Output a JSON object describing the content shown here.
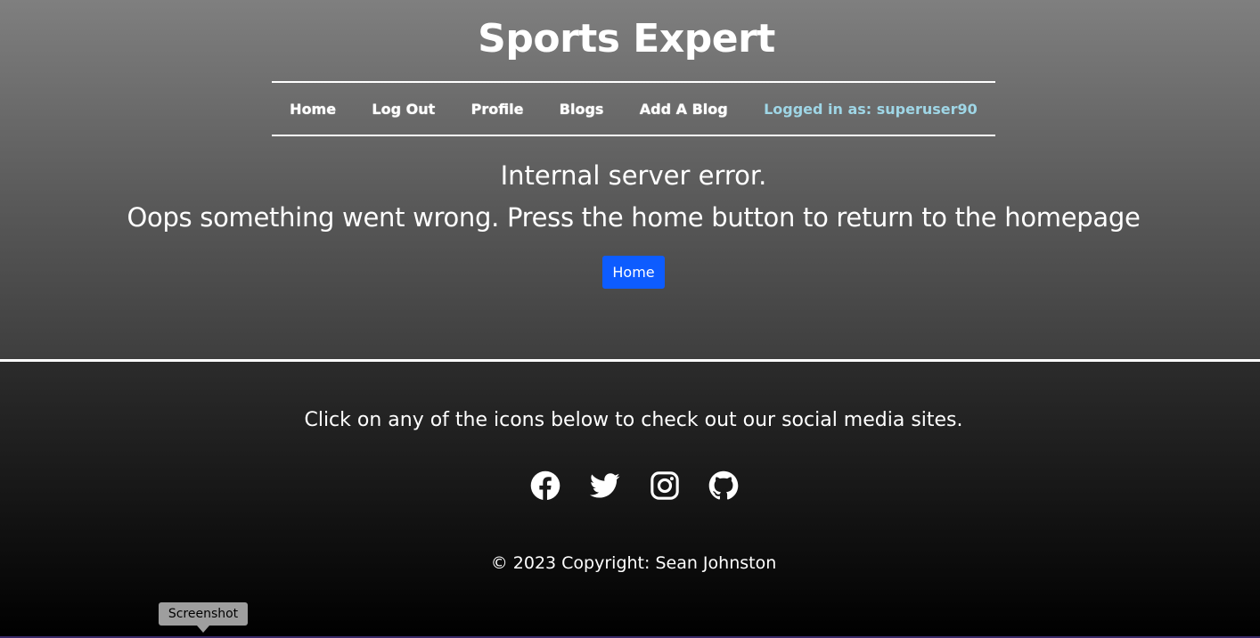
{
  "header": {
    "title": "Sports Expert"
  },
  "nav": {
    "items": [
      {
        "label": "Home"
      },
      {
        "label": "Log Out"
      },
      {
        "label": "Profile"
      },
      {
        "label": "Blogs"
      },
      {
        "label": "Add A Blog"
      }
    ],
    "login_status": "Logged in as: superuser90"
  },
  "main": {
    "error_title": "Internal server error.",
    "error_message": "Oops something went wrong. Press the home button to return to the homepage",
    "home_button_label": "Home"
  },
  "footer": {
    "social_text": "Click on any of the icons below to check out our social media sites.",
    "social_icons": [
      "facebook-icon",
      "twitter-icon",
      "instagram-icon",
      "github-icon"
    ],
    "copyright": "© 2023 Copyright: Sean Johnston"
  },
  "tooltip": {
    "label": "Screenshot"
  },
  "colors": {
    "accent_button": "#0d5cff",
    "login_status": "#9fd6e6"
  }
}
